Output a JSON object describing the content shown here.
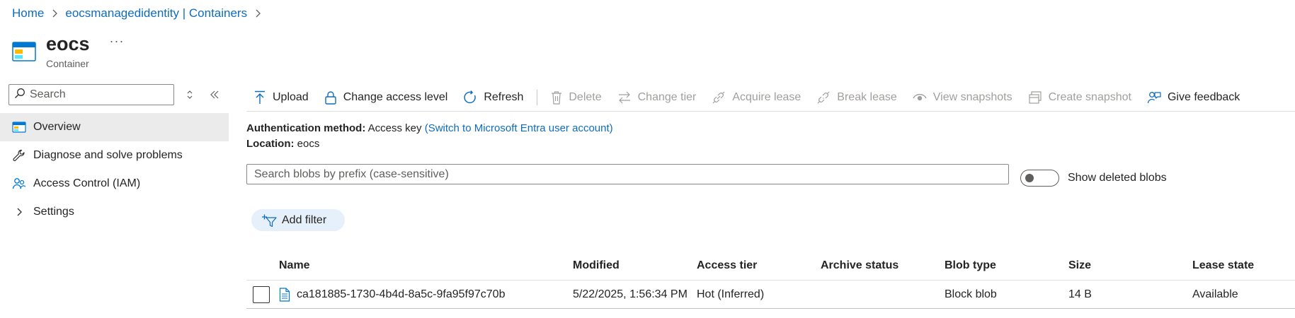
{
  "breadcrumb": {
    "home": "Home",
    "parent": "eocsmanagedidentity | Containers"
  },
  "header": {
    "title": "eocs",
    "subtitle": "Container",
    "more": "···"
  },
  "sidebar": {
    "search_placeholder": "Search",
    "items": [
      {
        "label": "Overview",
        "icon": "container-icon"
      },
      {
        "label": "Diagnose and solve problems",
        "icon": "wrench-icon"
      },
      {
        "label": "Access Control (IAM)",
        "icon": "people-icon"
      },
      {
        "label": "Settings",
        "icon": "chevron-right-icon"
      }
    ]
  },
  "toolbar": {
    "upload": "Upload",
    "change_access": "Change access level",
    "refresh": "Refresh",
    "delete": "Delete",
    "change_tier": "Change tier",
    "acquire_lease": "Acquire lease",
    "break_lease": "Break lease",
    "view_snapshots": "View snapshots",
    "create_snapshot": "Create snapshot",
    "give_feedback": "Give feedback"
  },
  "info": {
    "auth_label": "Authentication method:",
    "auth_value": "Access key",
    "auth_link": "(Switch to Microsoft Entra user account)",
    "location_label": "Location:",
    "location_value": "eocs"
  },
  "blob_search": {
    "placeholder": "Search blobs by prefix (case-sensitive)"
  },
  "show_deleted": {
    "label": "Show deleted blobs",
    "checked": false
  },
  "filter": {
    "label": "Add filter"
  },
  "table": {
    "columns": [
      "Name",
      "Modified",
      "Access tier",
      "Archive status",
      "Blob type",
      "Size",
      "Lease state"
    ],
    "rows": [
      {
        "name": "ca181885-1730-4b4d-8a5c-9fa95f97c70b",
        "modified": "5/22/2025, 1:56:34 PM",
        "access_tier": "Hot (Inferred)",
        "archive_status": "",
        "blob_type": "Block blob",
        "size": "14 B",
        "lease_state": "Available"
      }
    ]
  },
  "colors": {
    "link": "#0f6cbd",
    "disabled": "#a19f9d",
    "active_nav": "#ebebeb",
    "filter_pill": "#e6f0fa"
  }
}
